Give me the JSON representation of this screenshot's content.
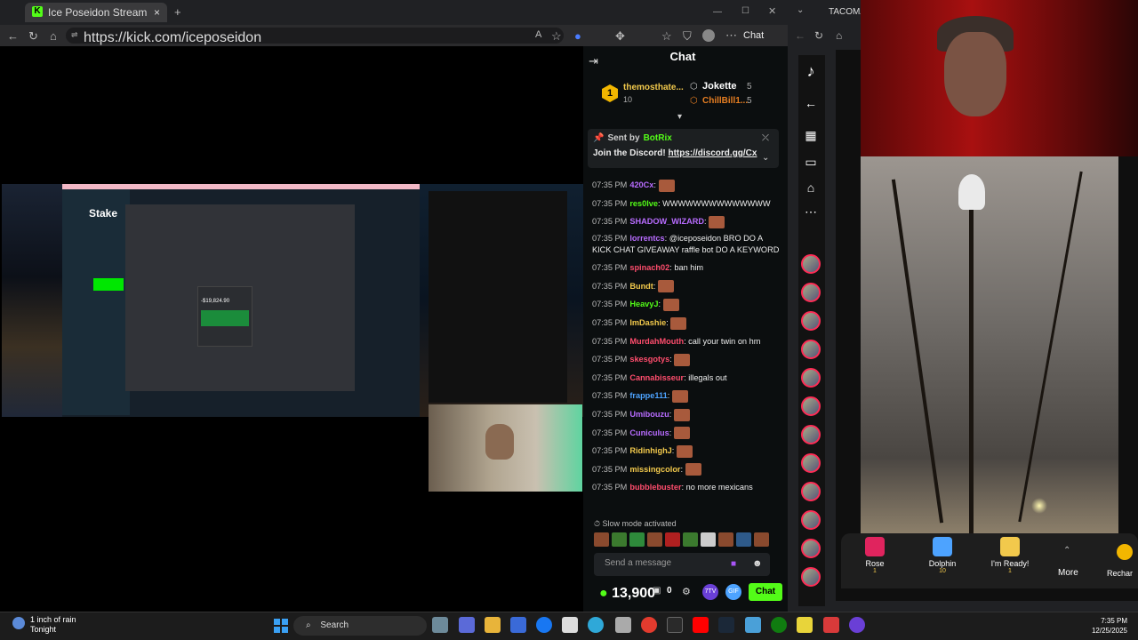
{
  "browser1": {
    "tab_title": "Ice Poseidon Stream - Watch",
    "tab_close": "×",
    "new_tab": "+",
    "url": "https://kick.com/iceposeidon",
    "chat_button": "Chat"
  },
  "stream": {
    "stake_logo": "Stake",
    "popup_amount": "-$19,824.90"
  },
  "chat": {
    "header": "Chat",
    "gifters": [
      {
        "name": "themosthate...",
        "count": "10"
      },
      {
        "name": "Jokette",
        "count": "5"
      },
      {
        "name": "ChillBill1...",
        "count": "5"
      }
    ],
    "gold_badge": "1",
    "pinned": {
      "sent_by_label": "Sent by",
      "sender": "BotRix",
      "text": "Join the Discord!",
      "link": "https://discord.gg/Cx"
    },
    "messages": [
      {
        "time": "07:35 PM",
        "user": "420Cx",
        "color": "#b86cff",
        "text": ""
      },
      {
        "time": "07:35 PM",
        "user": "res0lve",
        "color": "#53fc18",
        "text": "WWWWWWWWWWWWWW"
      },
      {
        "time": "07:35 PM",
        "user": "SHADOW_WIZARD",
        "color": "#b86cff",
        "text": ""
      },
      {
        "time": "07:35 PM",
        "user": "lorrentcs",
        "color": "#b86cff",
        "text": "@iceposeidon BRO DO A KICK CHAT GIVEAWAY raffle bot DO A KEYWORD"
      },
      {
        "time": "07:35 PM",
        "user": "spinach02",
        "color": "#ff4d6d",
        "text": "ban him"
      },
      {
        "time": "07:35 PM",
        "user": "Bundt",
        "color": "#f2c94c",
        "text": ""
      },
      {
        "time": "07:35 PM",
        "user": "HeavyJ",
        "color": "#53fc18",
        "text": ""
      },
      {
        "time": "07:35 PM",
        "user": "ImDashie",
        "color": "#f2c94c",
        "text": ""
      },
      {
        "time": "07:35 PM",
        "user": "MurdahMouth",
        "color": "#ff4d6d",
        "text": "call your twin on hm"
      },
      {
        "time": "07:35 PM",
        "user": "skesgotys",
        "color": "#ff4d6d",
        "text": ""
      },
      {
        "time": "07:35 PM",
        "user": "Cannabisseur",
        "color": "#ff4d6d",
        "text": "illegals out"
      },
      {
        "time": "07:35 PM",
        "user": "frappe111",
        "color": "#4da3ff",
        "text": ""
      },
      {
        "time": "07:35 PM",
        "user": "Umibouzu",
        "color": "#b86cff",
        "text": ""
      },
      {
        "time": "07:35 PM",
        "user": "Cuniculus",
        "color": "#b86cff",
        "text": ""
      },
      {
        "time": "07:35 PM",
        "user": "RidinhighJ",
        "color": "#f2c94c",
        "text": ""
      },
      {
        "time": "07:35 PM",
        "user": "missingcolor",
        "color": "#f2c94c",
        "text": ""
      },
      {
        "time": "07:35 PM",
        "user": "bubblebuster",
        "color": "#ff4d6d",
        "text": "no more mexicans"
      }
    ],
    "slow_mode": "Slow mode activated",
    "input_placeholder": "Send a message",
    "points": "13,900",
    "zero_count": "0",
    "pill_7tv": "7TV",
    "pill_gif": "GIF",
    "send_button": "Chat"
  },
  "browser2": {
    "tab_title": "TACOMA",
    "gifts": [
      {
        "name": "Rose",
        "cost": "1",
        "color": "#e0245e"
      },
      {
        "name": "Dolphin",
        "cost": "10",
        "color": "#4da3ff"
      },
      {
        "name": "I'm Ready!",
        "cost": "1",
        "color": "#f2c94c"
      }
    ],
    "more": "More",
    "recharge": "Rechar"
  },
  "taskbar": {
    "weather_line1": "1 inch of rain",
    "weather_line2": "Tonight",
    "search": "Search",
    "time": "7:35 PM",
    "date": "12/25/2025"
  }
}
